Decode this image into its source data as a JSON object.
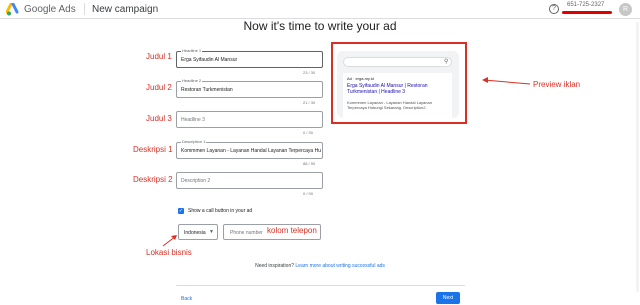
{
  "header": {
    "brand": "Google Ads",
    "campaign": "New campaign",
    "help_icon": "question-mark",
    "account_id": "651-725-2327",
    "avatar_letter": "R"
  },
  "page": {
    "title": "Now it's time to write your ad"
  },
  "fields": {
    "headline1": {
      "label": "Headline 1",
      "value": "Erga Syifaudin Al Mansur",
      "count": "23 / 30"
    },
    "headline2": {
      "label": "Headline 2",
      "value": "Restoran Turkmenistan",
      "count": "21 / 30"
    },
    "headline3": {
      "placeholder": "Headline 3",
      "count": "0 / 30"
    },
    "description1": {
      "label": "Description 1",
      "value": "Kommmen Layanan - Layanan Handal Layanan Terpercaya Hu",
      "count": "88 / 90"
    },
    "description2": {
      "placeholder": "Description 2",
      "count": "0 / 90"
    }
  },
  "annotations": {
    "judul1": "Judul 1",
    "judul2": "Judul 2",
    "judul3": "Judul 3",
    "deskripsi1": "Deskripsi 1",
    "deskripsi2": "Deskripsi 2",
    "preview": "Preview iklan",
    "kolom_telepon": "kolom telepon",
    "lokasi_bisnis": "Lokasi bisnis"
  },
  "preview": {
    "ad_line": "Ad · erga.my.id",
    "headline": "Erga Syifaudin Al Mansur | Restoran Turkmenistan | Headline 3",
    "description": "Kommmen Layanan - Layanan Handal Layanan Terpercaya Hubungi Sekarang. Description2."
  },
  "call": {
    "checkbox_label": "Show a call button in your ad",
    "country": "Indonesia",
    "phone_placeholder": "Phone number"
  },
  "inspiration": {
    "text": "Need inspiration?",
    "link": "Learn more about writing successful ads"
  },
  "footer": {
    "back": "Back",
    "next": "Next"
  },
  "colors": {
    "accent": "#1a73e8",
    "annotation": "#d93025"
  }
}
